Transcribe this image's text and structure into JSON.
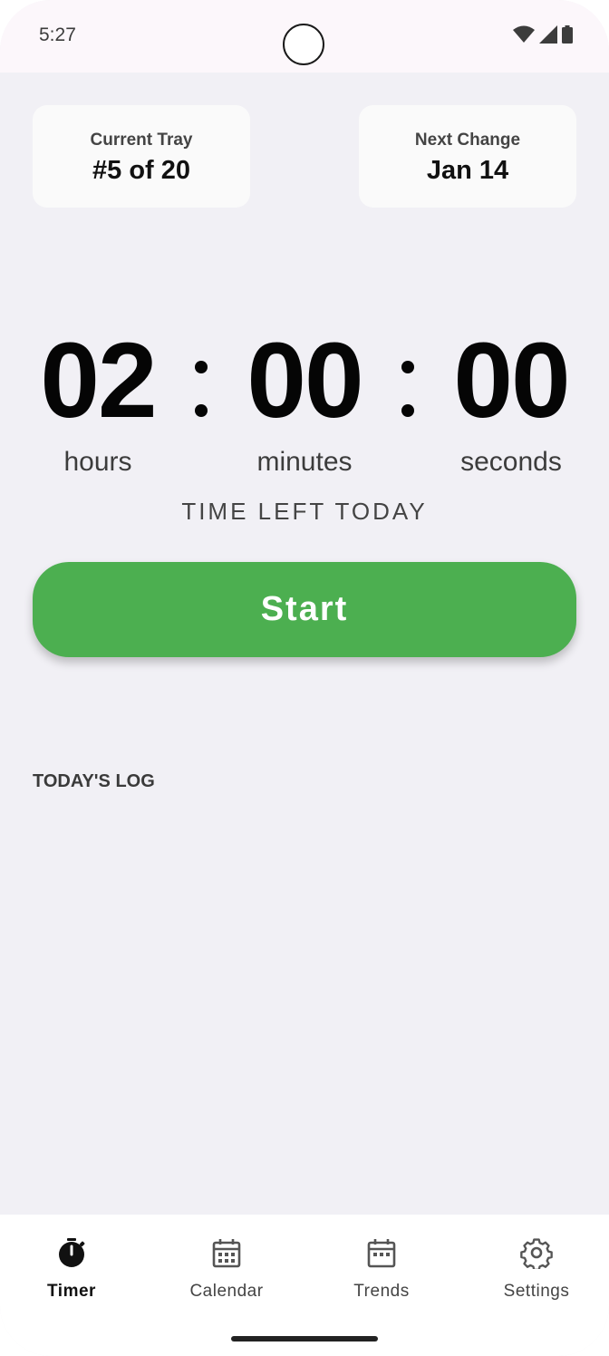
{
  "status_bar": {
    "time": "5:27"
  },
  "cards": {
    "current_tray": {
      "label": "Current Tray",
      "value": "#5 of 20"
    },
    "next_change": {
      "label": "Next Change",
      "value": "Jan 14"
    }
  },
  "timer": {
    "hours": "02",
    "minutes": "00",
    "seconds": "00",
    "hours_label": "hours",
    "minutes_label": "minutes",
    "seconds_label": "seconds",
    "caption": "TIME LEFT TODAY"
  },
  "start_button": {
    "label": "Start",
    "color": "#4caf50"
  },
  "log": {
    "title": "TODAY'S LOG"
  },
  "nav": {
    "items": [
      {
        "label": "Timer",
        "icon": "stopwatch-icon",
        "active": true
      },
      {
        "label": "Calendar",
        "icon": "calendar-icon",
        "active": false
      },
      {
        "label": "Trends",
        "icon": "calendar-icon",
        "active": false
      },
      {
        "label": "Settings",
        "icon": "gear-icon",
        "active": false
      }
    ]
  }
}
